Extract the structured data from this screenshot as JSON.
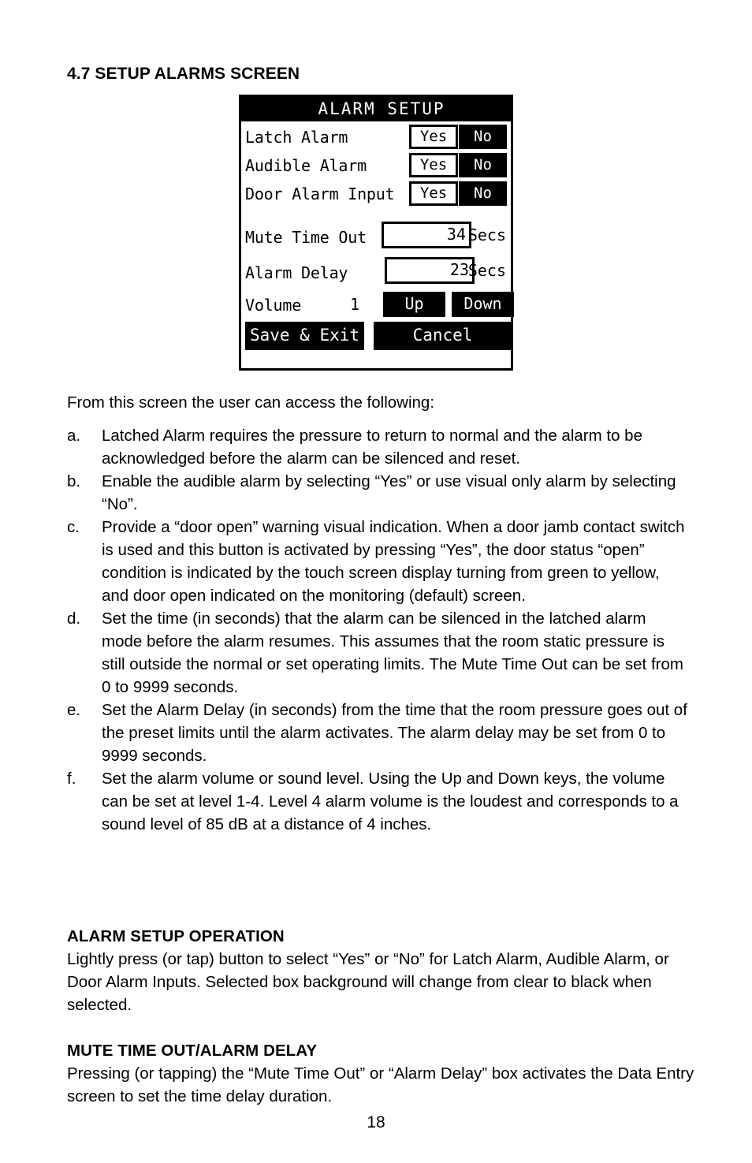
{
  "document": {
    "section_number_title": "4.7 SETUP ALARMS SCREEN",
    "page_number": "18"
  },
  "device_screen": {
    "title": "ALARM SETUP",
    "toggle_rows": [
      {
        "label": "Latch Alarm",
        "yes_label": "Yes",
        "no_label": "No",
        "selected": "No"
      },
      {
        "label": "Audible Alarm",
        "yes_label": "Yes",
        "no_label": "No",
        "selected": "No"
      },
      {
        "label": "Door Alarm Input",
        "yes_label": "Yes",
        "no_label": "No",
        "selected": "No"
      }
    ],
    "mute_time_out": {
      "label": "Mute Time Out",
      "value": "34",
      "units": "Secs"
    },
    "alarm_delay": {
      "label": "Alarm Delay",
      "value": "23",
      "units": "Secs"
    },
    "volume": {
      "label": "Volume",
      "value": "1",
      "up_label": "Up",
      "down_label": "Down"
    },
    "actions": {
      "save_label": "Save & Exit",
      "cancel_label": "Cancel"
    },
    "colors": {
      "screen_background": "#ffffff",
      "foreground": "#000000",
      "selected_background": "#000000",
      "selected_text": "#ffffff"
    }
  },
  "body": {
    "intro": "From this screen the user can access the following:",
    "list": [
      {
        "marker": "a.",
        "text": "Latched Alarm requires the pressure to return to normal and the alarm to be acknowledged before the alarm can be silenced and reset."
      },
      {
        "marker": "b.",
        "text": "Enable the audible alarm by selecting “Yes” or use visual only alarm by selecting “No”."
      },
      {
        "marker": "c.",
        "text": "Provide a “door open” warning visual indication. When a door jamb contact switch is used and this button is activated by pressing “Yes”, the door status “open” condition is indicated by the touch screen display turning from green to yellow, and door open indicated on the monitoring (default) screen."
      },
      {
        "marker": "d.",
        "text": "Set the time (in seconds) that the alarm can be silenced in the latched alarm mode before the alarm resumes. This assumes that the room static pressure is still outside the normal or set operating limits. The Mute Time Out can be set from 0 to 9999 seconds."
      },
      {
        "marker": "e.",
        "text": "Set the Alarm Delay (in seconds) from the time that the room pressure goes out of the preset limits until the alarm activates. The alarm delay may be set from 0 to 9999 seconds."
      },
      {
        "marker": "f.",
        "text": "Set the alarm volume or sound level. Using the Up and Down keys, the volume can be set at level 1-4. Level 4 alarm volume is the loudest and corresponds to a sound level of 85 dB at a distance of 4 inches."
      }
    ],
    "alarm_setup_operation": {
      "heading": "ALARM SETUP OPERATION",
      "text": "Lightly press (or tap) button to select “Yes” or “No” for Latch Alarm, Audible Alarm, or Door Alarm Inputs. Selected box background will change from clear to black when selected."
    },
    "mute_time_out_alarm_delay": {
      "heading": "MUTE TIME OUT/ALARM DELAY",
      "text": "Pressing (or tapping) the “Mute Time Out” or “Alarm Delay” box activates the Data Entry screen to set the time delay duration."
    }
  }
}
